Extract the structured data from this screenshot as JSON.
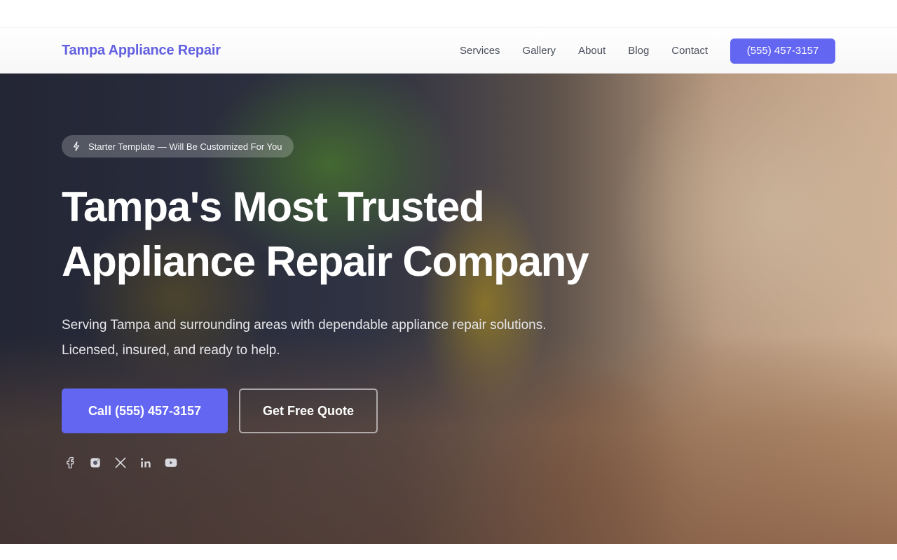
{
  "brand": {
    "name": "Tampa Appliance Repair",
    "color": "#6461e0"
  },
  "nav": {
    "links": [
      "Services",
      "Gallery",
      "About",
      "Blog",
      "Contact"
    ],
    "cta": "(555) 457-3157"
  },
  "hero": {
    "badge": "Starter Template — Will Be Customized For You",
    "badge_icon": "sparkle-icon",
    "title_line1": "Tampa's Most Trusted",
    "title_line2": "Appliance Repair Company",
    "subtitle": "Serving Tampa and surrounding areas with dependable appliance repair solutions. Licensed, insured, and ready to help.",
    "primary_button": "Call (555) 457-3157",
    "secondary_button": "Get Free Quote",
    "socials": [
      "facebook-icon",
      "instagram-icon",
      "x-icon",
      "linkedin-icon",
      "youtube-icon"
    ]
  },
  "colors": {
    "accent": "#6366f1",
    "nav_text": "#4a4f5c"
  }
}
